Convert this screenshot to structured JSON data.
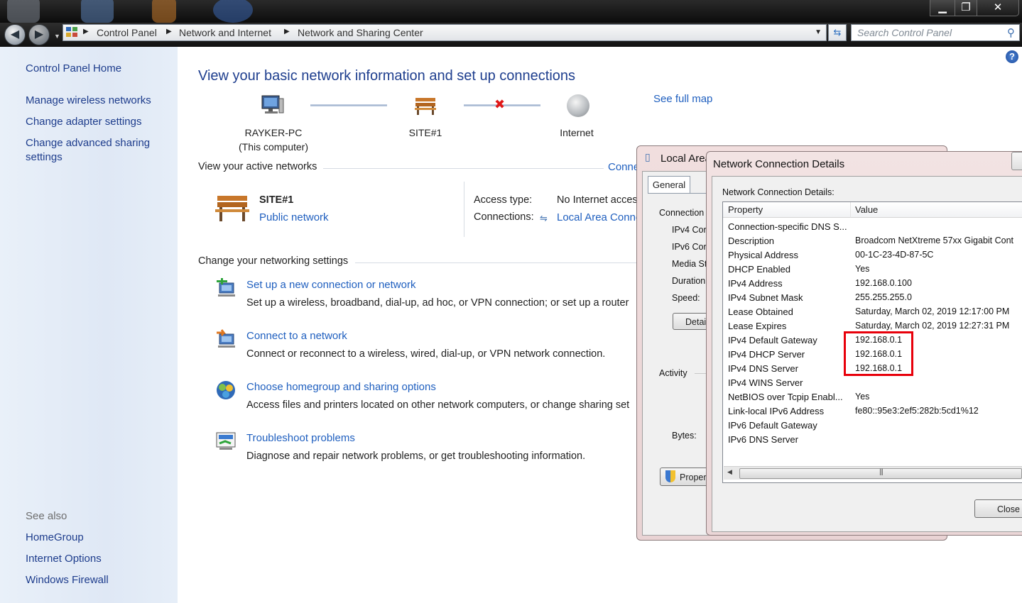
{
  "window": {
    "controls": {
      "minimize": "▁",
      "maximize": "❐",
      "close": "✕"
    }
  },
  "addressbar": {
    "breadcrumbs": [
      "Control Panel",
      "Network and Internet",
      "Network and Sharing Center"
    ],
    "search_placeholder": "Search Control Panel"
  },
  "sidebar": {
    "home": "Control Panel Home",
    "items": [
      "Manage wireless networks",
      "Change adapter settings",
      "Change advanced sharing settings"
    ],
    "see_also_title": "See also",
    "see_also": [
      "HomeGroup",
      "Internet Options",
      "Windows Firewall"
    ]
  },
  "main": {
    "heading": "View your basic network information and set up connections",
    "see_full_map": "See full map",
    "map": {
      "computer_name": "RAYKER-PC",
      "computer_sub": "(This computer)",
      "network": "SITE#1",
      "internet": "Internet"
    },
    "active_networks": {
      "title": "View your active networks",
      "connect_link": "Conne",
      "name": "SITE#1",
      "type": "Public network",
      "access_type_label": "Access type:",
      "access_type_value": "No Internet acces",
      "connections_label": "Connections:",
      "connections_value": "Local Area Conne"
    },
    "settings": {
      "title": "Change your networking settings",
      "tasks": [
        {
          "title": "Set up a new connection or network",
          "desc": "Set up a wireless, broadband, dial-up, ad hoc, or VPN connection; or set up a router"
        },
        {
          "title": "Connect to a network",
          "desc": "Connect or reconnect to a wireless, wired, dial-up, or VPN network connection."
        },
        {
          "title": "Choose homegroup and sharing options",
          "desc": "Access files and printers located on other network computers, or change sharing set"
        },
        {
          "title": "Troubleshoot problems",
          "desc": "Diagnose and repair network problems, or get troubleshooting information."
        }
      ]
    }
  },
  "status_window": {
    "title": "Local Area",
    "tab": "General",
    "connection_label": "Connection",
    "rows": [
      "IPv4 Cor",
      "IPv6 Cor",
      "Media St",
      "Duration",
      "Speed:"
    ],
    "details_button": "Detai",
    "activity_label": "Activity",
    "bytes_label": "Bytes:",
    "properties_button": "Proper"
  },
  "details_window": {
    "title": "Network Connection Details",
    "subtitle": "Network Connection Details:",
    "columns": [
      "Property",
      "Value"
    ],
    "rows": [
      {
        "property": "Connection-specific DNS S...",
        "value": ""
      },
      {
        "property": "Description",
        "value": "Broadcom NetXtreme 57xx Gigabit Cont"
      },
      {
        "property": "Physical Address",
        "value": "00-1C-23-4D-87-5C"
      },
      {
        "property": "DHCP Enabled",
        "value": "Yes"
      },
      {
        "property": "IPv4 Address",
        "value": "192.168.0.100"
      },
      {
        "property": "IPv4 Subnet Mask",
        "value": "255.255.255.0"
      },
      {
        "property": "Lease Obtained",
        "value": "Saturday, March 02, 2019 12:17:00 PM"
      },
      {
        "property": "Lease Expires",
        "value": "Saturday, March 02, 2019 12:27:31 PM"
      },
      {
        "property": "IPv4 Default Gateway",
        "value": "192.168.0.1"
      },
      {
        "property": "IPv4 DHCP Server",
        "value": "192.168.0.1"
      },
      {
        "property": "IPv4 DNS Server",
        "value": "192.168.0.1"
      },
      {
        "property": "IPv4 WINS Server",
        "value": ""
      },
      {
        "property": "NetBIOS over Tcpip Enabl...",
        "value": "Yes"
      },
      {
        "property": "Link-local IPv6 Address",
        "value": "fe80::95e3:2ef5:282b:5cd1%12"
      },
      {
        "property": "IPv6 Default Gateway",
        "value": ""
      },
      {
        "property": "IPv6 DNS Server",
        "value": ""
      }
    ],
    "close_button": "Close"
  },
  "colors": {
    "link": "#1f5fbf",
    "heading": "#1e3e8e",
    "highlight": "#e8000b"
  }
}
